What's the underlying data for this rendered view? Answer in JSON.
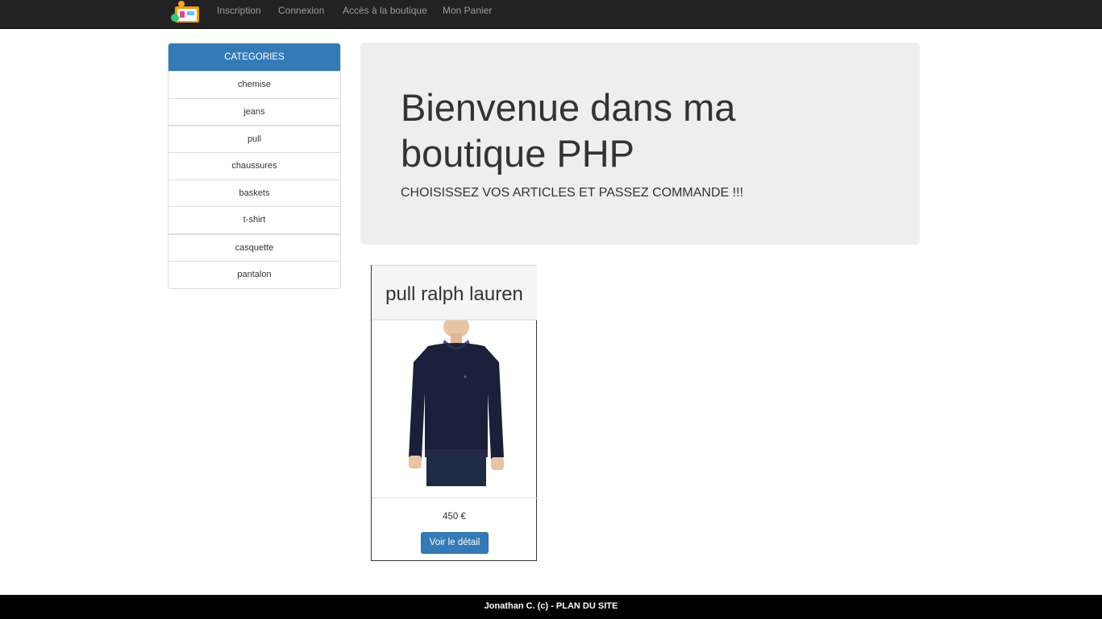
{
  "nav": {
    "logo_icon": "shop-icon",
    "links": [
      "Inscription",
      "Connexion",
      "Accès à la boutique",
      "Mon Panier"
    ]
  },
  "sidebar": {
    "header": "CATEGORIES",
    "items": [
      "chemise",
      "jeans",
      "pull",
      "chaussures",
      "baskets",
      "t-shirt",
      "casquette",
      "pantalon"
    ]
  },
  "hero": {
    "title": "Bienvenue dans ma boutique PHP",
    "subtitle": "CHOISISSEZ VOS ARTICLES ET PASSEZ COMMANDE !!!"
  },
  "products": [
    {
      "name": "pull ralph lauren",
      "price": "450 €",
      "button": "Voir le détail"
    }
  ],
  "footer": {
    "text": "Jonathan C. (c) - PLAN DU SITE"
  },
  "colors": {
    "primary": "#337ab7",
    "navbar": "#222222",
    "jumbotron": "#eeeeee",
    "footer": "#000000"
  }
}
